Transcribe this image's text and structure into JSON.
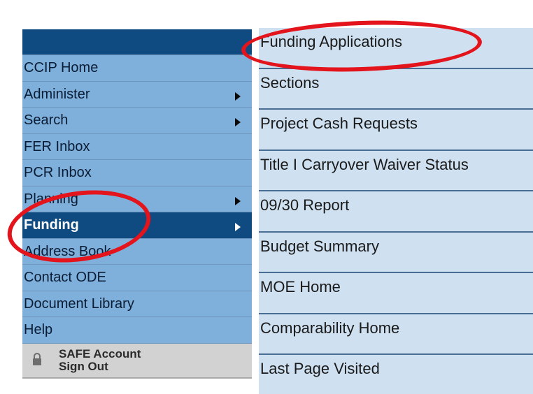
{
  "left_nav": {
    "items": [
      {
        "label": "CCIP Home",
        "submenu": false,
        "active": false
      },
      {
        "label": "Administer",
        "submenu": true,
        "active": false
      },
      {
        "label": "Search",
        "submenu": true,
        "active": false
      },
      {
        "label": "FER Inbox",
        "submenu": false,
        "active": false
      },
      {
        "label": "PCR Inbox",
        "submenu": false,
        "active": false
      },
      {
        "label": "Planning",
        "submenu": true,
        "active": false
      },
      {
        "label": "Funding",
        "submenu": true,
        "active": true
      },
      {
        "label": "Address Book",
        "submenu": false,
        "active": false
      },
      {
        "label": "Contact ODE",
        "submenu": false,
        "active": false
      },
      {
        "label": "Document Library",
        "submenu": false,
        "active": false
      },
      {
        "label": "Help",
        "submenu": false,
        "active": false
      }
    ],
    "signout": {
      "line1": "SAFE Account",
      "line2": "Sign Out",
      "icon": "lock-icon"
    }
  },
  "funding_submenu": {
    "items": [
      "Funding Applications",
      "Sections",
      "Project Cash Requests",
      "Title I Carryover Waiver Status",
      "09/30 Report",
      "Budget Summary",
      "MOE Home",
      "Comparability Home",
      "Last Page Visited"
    ]
  },
  "colors": {
    "nav_dark": "#0f4a80",
    "nav_item": "#7fb0dc",
    "submenu_bg": "#cfe1f1",
    "annotation": "#e3141b"
  }
}
